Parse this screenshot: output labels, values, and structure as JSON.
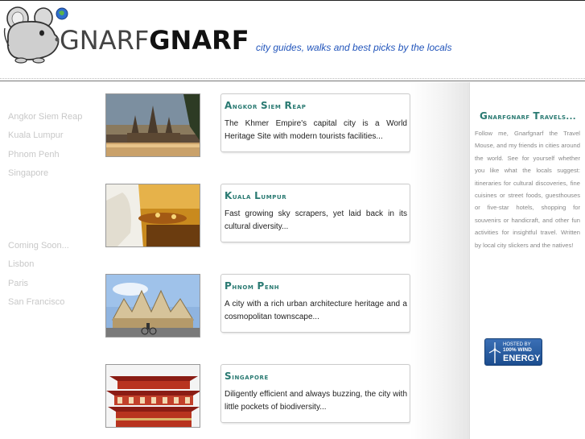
{
  "header": {
    "logo_part1": "GNARF",
    "logo_part2": "GNARF",
    "tagline": "city guides, walks and best picks by the locals"
  },
  "nav": {
    "cities": [
      "Angkor Siem Reap",
      "Kuala Lumpur",
      "Phnom Penh",
      "Singapore"
    ],
    "coming_soon_label": "Coming Soon...",
    "coming_soon": [
      "Lisbon",
      "Paris",
      "San Francisco"
    ]
  },
  "cards": [
    {
      "title_cap": "A",
      "title_rest": "ngkor ",
      "title_cap2": "S",
      "title_rest2": "iem ",
      "title_cap3": "R",
      "title_rest3": "eap",
      "desc": "The Khmer Empire's capital city is a World Heritage Site with modern tourists facilities...",
      "photo_icon": "temple-photo"
    },
    {
      "title_cap": "K",
      "title_rest": "uala ",
      "title_cap2": "L",
      "title_rest2": "umpur",
      "title_cap3": "",
      "title_rest3": "",
      "desc": "Fast growing sky scrapers, yet laid back in its cultural diversity...",
      "photo_icon": "street-food-photo"
    },
    {
      "title_cap": "P",
      "title_rest": "hnom ",
      "title_cap2": "P",
      "title_rest2": "enh",
      "title_cap3": "",
      "title_rest3": "",
      "desc": "A city with a rich urban architecture heritage and a cosmopolitan townscape...",
      "photo_icon": "market-building-photo"
    },
    {
      "title_cap": "S",
      "title_rest": "ingapore",
      "title_cap2": "",
      "title_rest2": "",
      "title_cap3": "",
      "title_rest3": "",
      "desc": "Diligently efficient and always buzzing, the city with little pockets of biodiversity...",
      "photo_icon": "pagoda-photo"
    }
  ],
  "sidebar": {
    "title_cap": "G",
    "title_rest": "narfgnarf ",
    "title_cap2": "T",
    "title_rest2": "ravels...",
    "text": "Follow me, Gnarfgnarf the Travel Mouse, and my friends in cities around the world. See for yourself whether you like what the locals suggest: itineraries for cultural discoveries, fine cuisines or street foods, guesthouses or five-star hotels, shopping for souvenirs or handicraft, and other fun activities for insightful travel. Written by local city slickers and the natives!",
    "badge_small": "HOSTED BY",
    "badge_mid": "100% WIND",
    "badge_big": "ENERGY"
  },
  "colors": {
    "accent_teal": "#2a7a72",
    "tagline_blue": "#2255bb",
    "nav_gray": "#c8c8c8",
    "badge_blue": "#1c4d8f"
  }
}
